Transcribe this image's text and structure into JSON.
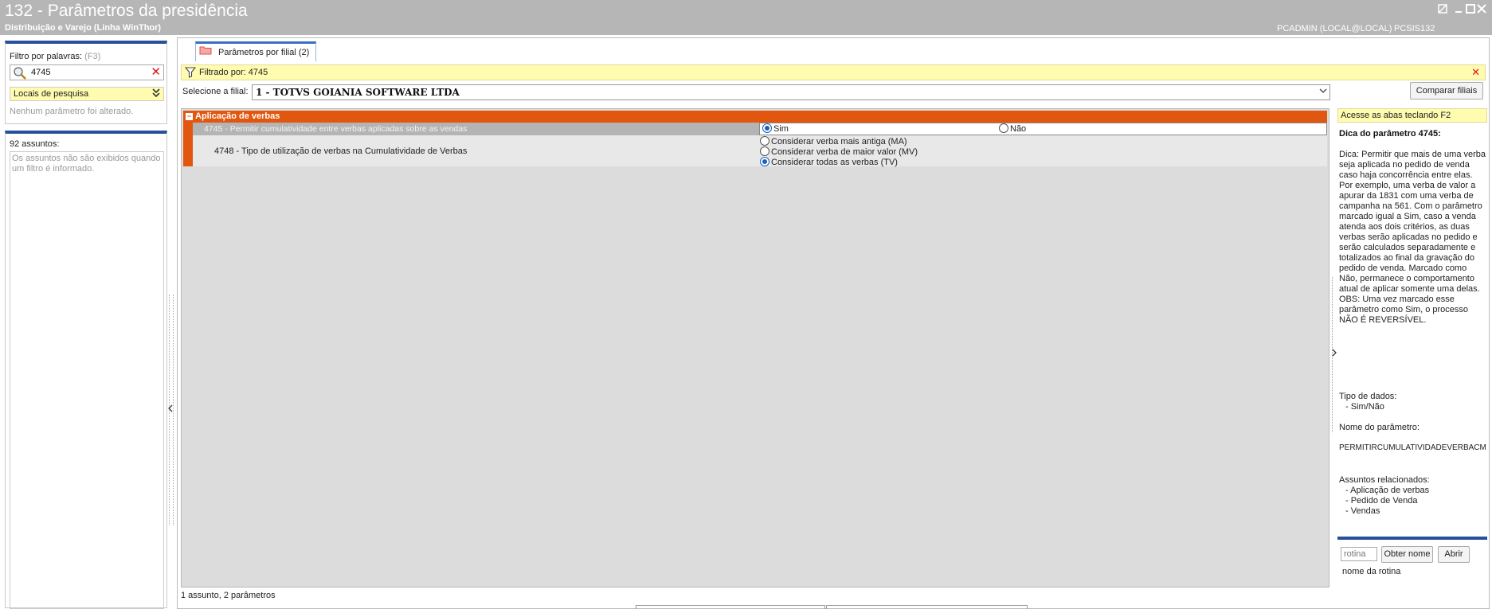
{
  "window": {
    "title": "132 - Parâmetros da presidência",
    "subtitle": "Distribuição e Varejo (Linha WinThor)",
    "user": "PCADMIN (LOCAL@LOCAL)",
    "routine": "PCSIS132",
    "controls": [
      "restore-icon",
      "minimize-icon",
      "maximize-icon",
      "close-icon"
    ]
  },
  "left": {
    "filter_label": "Filtro por palavras:",
    "filter_shortcut": "(F3)",
    "search_value": "4745",
    "search_clear": "✕",
    "locais_label": "Locais de pesquisa",
    "locais_chevron": "»",
    "no_param_changed": "Nenhum parâmetro foi alterado.",
    "assuntos_count": "92 assuntos:",
    "assuntos_note": "Os assuntos não são exibidos quando um filtro é informado."
  },
  "main": {
    "tab_label": "Parâmetros por filial  (2)",
    "filter_text": "Filtrado por: 4745",
    "filter_clear": "✕",
    "filial_label": "Selecione a filial:",
    "filial_value": "1 - TOTVS GOIANIA SOFTWARE LTDA",
    "compare_button": "Comparar filiais",
    "group_title": "Aplicação de verbas",
    "group_toggle": "−",
    "params": [
      {
        "label": "4745 - Permitir cumulatividade entre verbas aplicadas sobre as vendas",
        "options": [
          "Sim",
          "Não"
        ],
        "selected": "Sim"
      },
      {
        "label": "4748 - Tipo de utilização de verbas na Cumulatividade de Verbas",
        "options": [
          "Considerar verba mais antiga (MA)",
          "Considerar verba de maior valor (MV)",
          "Considerar todas as verbas (TV)"
        ],
        "selected": "Considerar todas as verbas (TV)"
      }
    ],
    "status": "1 assunto, 2 parâmetros"
  },
  "right": {
    "hint": "Acesse as abas teclando F2",
    "tip_title": "Dica do parâmetro 4745:",
    "tip_body": "Dica: Permitir que mais de uma verba seja aplicada no pedido de venda caso haja concorrência entre elas. Por exemplo, uma verba de valor a apurar da 1831 com uma verba de campanha na 561. Com o parâmetro marcado igual a Sim, caso a venda atenda aos dois critérios, as duas verbas serão aplicadas no pedido e serão calculados separadamente e totalizados ao final da gravação do pedido de venda. Marcado como Não, permanece o comportamento atual de aplicar somente uma delas. OBS: Uma vez marcado esse parâmetro como Sim, o processo NÃO É REVERSÍVEL.",
    "tipo_label": "Tipo de dados:",
    "tipo_value": "- Sim/Não",
    "nome_label": "Nome do parâmetro:",
    "nome_value": "PERMITIRCUMULATIVIDADEVERBACM",
    "rel_label": "Assuntos relacionados:",
    "rel_items": [
      "- Aplicação de verbas",
      "- Pedido de Venda",
      "- Vendas"
    ],
    "routine_placeholder": "rotina",
    "obter_button": "Obter nome",
    "abrir_button": "Abrir",
    "routine_name": "nome da rotina"
  },
  "colors": {
    "accent": "#27509b",
    "group": "#e2570f",
    "highlight": "#fffcb0",
    "titlebar": "#b6b6b6"
  }
}
